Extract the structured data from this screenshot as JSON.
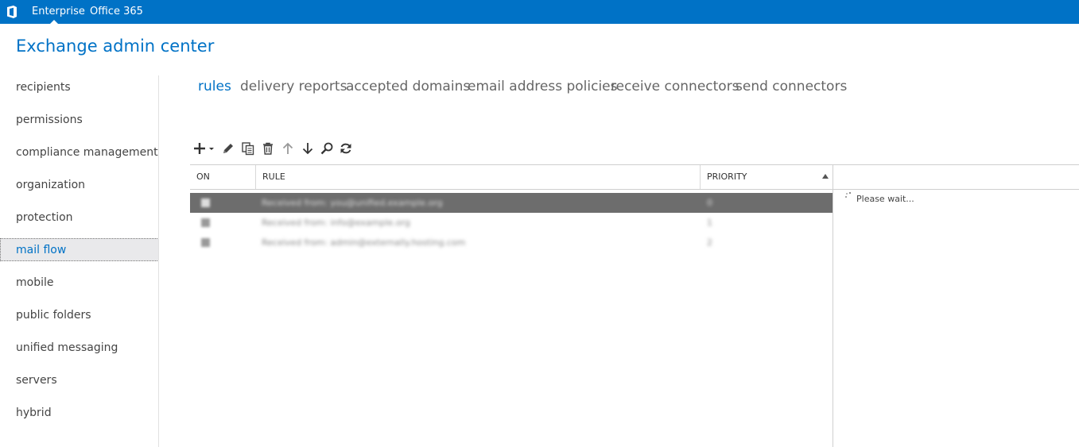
{
  "topbar": {
    "links": [
      "Enterprise",
      "Office 365"
    ],
    "active": "Enterprise",
    "color": "#0072c6"
  },
  "app": {
    "title": "Exchange admin center"
  },
  "nav": {
    "items": [
      "recipients",
      "permissions",
      "compliance management",
      "organization",
      "protection",
      "mail flow",
      "mobile",
      "public folders",
      "unified messaging",
      "servers",
      "hybrid"
    ],
    "selected": "mail flow"
  },
  "tabs": {
    "items": [
      "rules",
      "delivery reports",
      "accepted domains",
      "email address policies",
      "receive connectors",
      "send connectors"
    ],
    "active": "rules"
  },
  "toolbar": {
    "icons": [
      "add-icon",
      "edit-icon",
      "copy-icon",
      "delete-icon",
      "move-up-icon",
      "move-down-icon",
      "search-icon",
      "refresh-icon"
    ]
  },
  "grid": {
    "columns": [
      "ON",
      "RULE",
      "PRIORITY"
    ],
    "sort_column": "PRIORITY",
    "sort_direction": "ascending",
    "rows": [
      {
        "on": true,
        "rule": "Received from: you@unified.example.org",
        "priority": "0"
      },
      {
        "on": true,
        "rule": "Received from: info@example.org",
        "priority": "1"
      },
      {
        "on": true,
        "rule": "Received from: admin@externally.hosting.com",
        "priority": "2"
      }
    ]
  },
  "details": {
    "status": "Please wait..."
  }
}
